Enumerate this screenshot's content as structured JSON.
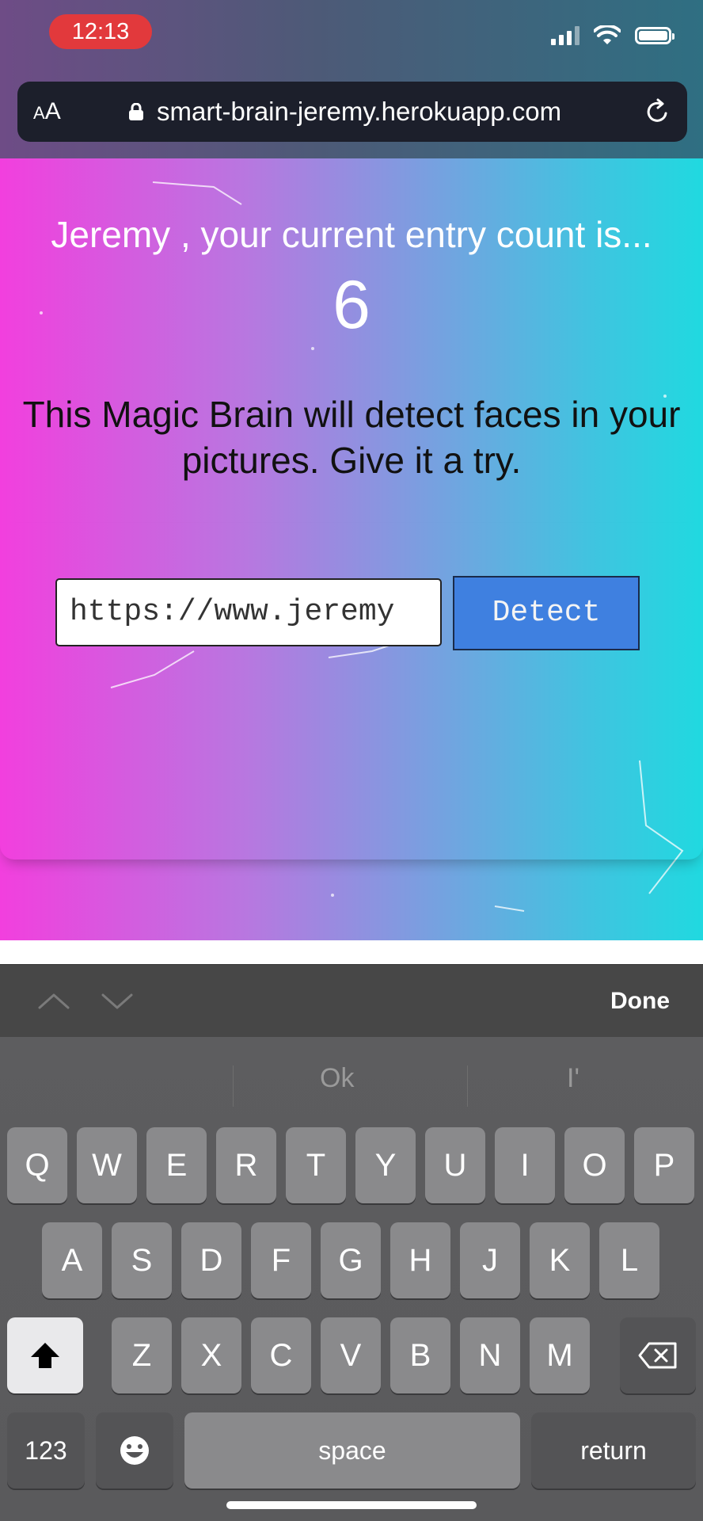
{
  "status_bar": {
    "time": "12:13"
  },
  "browser": {
    "text_size_label_small": "A",
    "text_size_label_large": "A",
    "url": "smart-brain-jeremy.herokuapp.com"
  },
  "page": {
    "entry_text": "Jeremy , your current entry count is...",
    "entry_count": "6",
    "description": "This Magic Brain will detect faces in your pictures. Give it a try.",
    "image_url_value": "https://www.jeremy",
    "detect_label": "Detect"
  },
  "keyboard_toolbar": {
    "done_label": "Done"
  },
  "keyboard": {
    "suggestions": [
      "",
      "Ok",
      "I'"
    ],
    "row1": [
      "Q",
      "W",
      "E",
      "R",
      "T",
      "Y",
      "U",
      "I",
      "O",
      "P"
    ],
    "row2": [
      "A",
      "S",
      "D",
      "F",
      "G",
      "H",
      "J",
      "K",
      "L"
    ],
    "row3": [
      "Z",
      "X",
      "C",
      "V",
      "B",
      "N",
      "M"
    ],
    "numbers_label": "123",
    "space_label": "space",
    "return_label": "return"
  }
}
